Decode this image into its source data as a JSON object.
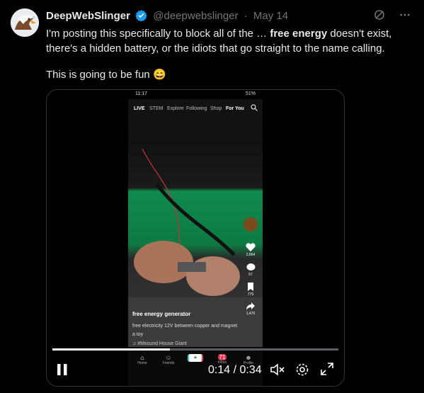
{
  "tweet": {
    "author_name": "DeepWebSlinger",
    "handle": "@deepwebslinger",
    "separator": "·",
    "date": "May 14",
    "text_part1": "I'm posting this specifically to block all of the … ",
    "text_highlight": "free energy",
    "text_part2": " doesn't exist, there's a hidden battery, or the idiots that go straight to the name calling.",
    "text_line2": "This is going to be fun",
    "emoji": "😄"
  },
  "video": {
    "current_time": "0:14",
    "duration": "0:34",
    "time_separator": " / ",
    "progress": 0.41,
    "phone": {
      "status_time": "11:17",
      "status_right": "51%",
      "nav_items": [
        "STEM",
        "Explore",
        "Following",
        "Shop",
        "For You"
      ],
      "live_label": "LIVE",
      "counts": {
        "likes": "2,664",
        "comments": "57",
        "saves": "779",
        "shares": "1,470"
      },
      "caption_title": "free energy generator",
      "caption_desc": "free electricity 12V between copper and magnet a toy",
      "caption_music": "♫ #Msound   House Giant",
      "bottom_tabs": [
        "Home",
        "Friends",
        "",
        "Inbox",
        "Profile"
      ],
      "inbox_badge": "71"
    }
  },
  "colors": {
    "background": "#000000",
    "verified": "#1d9bf0",
    "muted": "#71767b",
    "text": "#e7e9ea"
  },
  "icons": [
    "verified-badge-icon",
    "grok-icon",
    "more-icon",
    "pause-icon",
    "mute-icon",
    "settings-icon",
    "fullscreen-icon"
  ]
}
